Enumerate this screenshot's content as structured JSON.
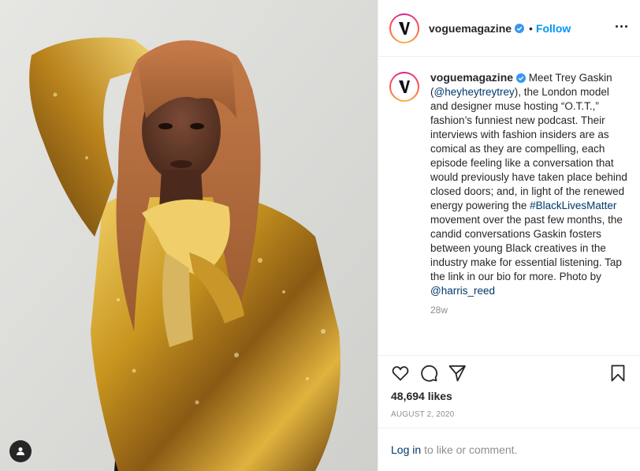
{
  "post": {
    "username": "voguemagazine",
    "follow_label": "Follow",
    "dot": "•",
    "caption_parts": [
      "Meet Trey Gaskin (",
      "@heyheytreytrey",
      "), the London model and designer muse hosting “O.T.T.,” fashion’s funniest new podcast. Their interviews with fashion insiders are as comical as they are compelling, each episode feeling like a conversation that would previously have taken place behind closed doors; and, in light of the renewed energy powering the ",
      "#BlackLivesMatter",
      " movement over the past few months, the candid conversations Gaskin fosters between young Black creatives in the industry make for essential listening. Tap the link in our bio for more. Photo by ",
      "@harris_reed"
    ],
    "time_ago": "28w",
    "likes": "48,694 likes",
    "date": "AUGUST 2, 2020",
    "login_link": "Log in",
    "login_text": "to like or comment.",
    "logo_letter": "V"
  },
  "icons": {
    "like": "heart-icon",
    "comment": "comment-icon",
    "share": "paper-plane-icon",
    "save": "bookmark-icon",
    "more": "more-options-icon",
    "verified": "verified-badge-icon",
    "tag": "user-tag-icon"
  },
  "colors": {
    "accent": "#0095f6",
    "link": "#00376b",
    "muted": "#8e8e8e",
    "text": "#262626",
    "sequin_gold": "#c9961f",
    "hair": "#b06a3c"
  }
}
